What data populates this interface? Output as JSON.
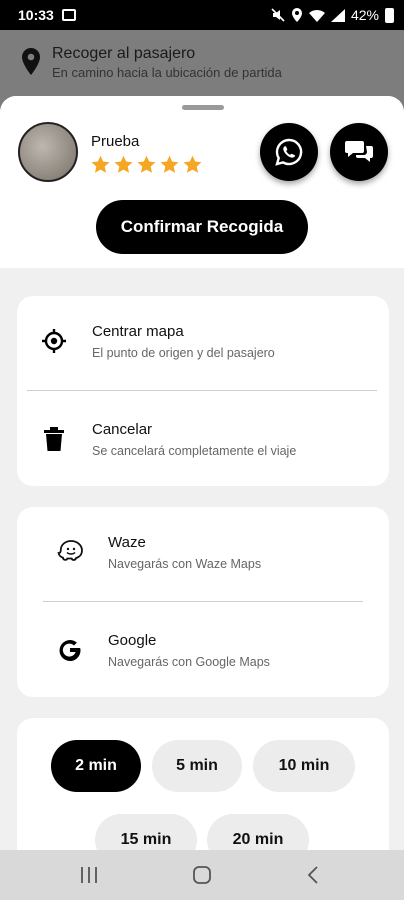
{
  "status_bar": {
    "time": "10:33",
    "battery": "42%"
  },
  "banner": {
    "title": "Recoger al pasajero",
    "subtitle": "En camino hacia la ubicación de partida"
  },
  "driver": {
    "name": "Prueba",
    "rating": 5,
    "star_color": "#f5a623"
  },
  "actions": {
    "confirm_label": "Confirmar Recogida"
  },
  "map_options": [
    {
      "title": "Centrar mapa",
      "subtitle": "El punto de origen y del pasajero",
      "icon": "crosshair-icon"
    },
    {
      "title": "Cancelar",
      "subtitle": "Se cancelará completamente el viaje",
      "icon": "trash-icon"
    }
  ],
  "navigation_apps": [
    {
      "title": "Waze",
      "subtitle": "Navegarás con Waze Maps",
      "icon": "waze-icon"
    },
    {
      "title": "Google",
      "subtitle": "Navegarás con Google Maps",
      "icon": "google-icon"
    }
  ],
  "time_options": {
    "selected": "2 min",
    "items": [
      "2 min",
      "5 min",
      "10 min",
      "15 min",
      "20 min"
    ]
  }
}
